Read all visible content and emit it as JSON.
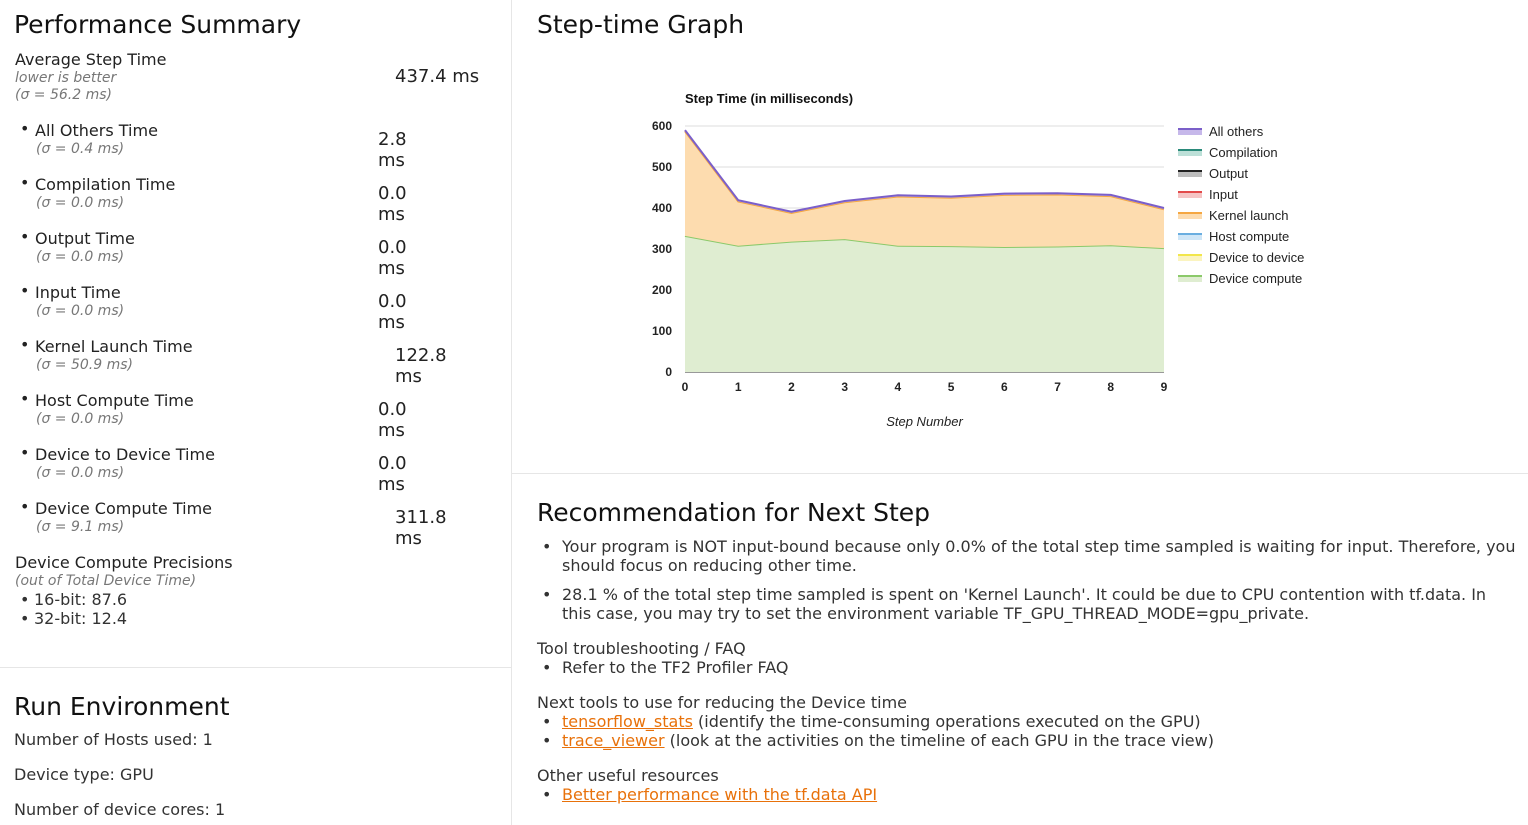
{
  "perf": {
    "title": "Performance Summary",
    "avg": {
      "name": "Average Step Time",
      "hint": "lower is better",
      "sigma": "(σ = 56.2 ms)",
      "value": "437.4 ms"
    },
    "breakdown": [
      {
        "name": "All Others Time",
        "sigma": "(σ = 0.4 ms)",
        "value": "2.8 ms"
      },
      {
        "name": "Compilation Time",
        "sigma": "(σ = 0.0 ms)",
        "value": "0.0 ms"
      },
      {
        "name": "Output Time",
        "sigma": "(σ = 0.0 ms)",
        "value": "0.0 ms"
      },
      {
        "name": "Input Time",
        "sigma": "(σ = 0.0 ms)",
        "value": "0.0 ms"
      },
      {
        "name": "Kernel Launch Time",
        "sigma": "(σ = 50.9 ms)",
        "value": "122.8 ms"
      },
      {
        "name": "Host Compute Time",
        "sigma": "(σ = 0.0 ms)",
        "value": "0.0 ms"
      },
      {
        "name": "Device to Device Time",
        "sigma": "(σ = 0.0 ms)",
        "value": "0.0 ms"
      },
      {
        "name": "Device Compute Time",
        "sigma": "(σ = 9.1 ms)",
        "value": "311.8 ms"
      }
    ],
    "precisions": {
      "title": "Device Compute Precisions",
      "sub": "(out of Total Device Time)",
      "items": [
        "16-bit: 87.6",
        "32-bit: 12.4"
      ]
    }
  },
  "run_env": {
    "title": "Run Environment",
    "hosts": "Number of Hosts used: 1",
    "device_type": "Device type: GPU",
    "cores": "Number of device cores: 1"
  },
  "graph_panel": {
    "title": "Step-time Graph"
  },
  "chart_data": {
    "type": "area",
    "title": "Step Time (in milliseconds)",
    "xlabel": "Step Number",
    "ylabel": "",
    "x": [
      0,
      1,
      2,
      3,
      4,
      5,
      6,
      7,
      8,
      9
    ],
    "ylim": [
      0,
      600
    ],
    "yticks": [
      0,
      100,
      200,
      300,
      400,
      500,
      600
    ],
    "stacked": true,
    "grid": true,
    "legend_position": "right",
    "series": [
      {
        "name": "All others",
        "color": "#7b5fc9",
        "values": [
          3,
          3,
          3,
          3,
          3,
          3,
          3,
          3,
          3,
          3
        ]
      },
      {
        "name": "Compilation",
        "color": "#2a8a7a",
        "values": [
          0,
          0,
          0,
          0,
          0,
          0,
          0,
          0,
          0,
          0
        ]
      },
      {
        "name": "Output",
        "color": "#222222",
        "values": [
          0,
          0,
          0,
          0,
          0,
          0,
          0,
          0,
          0,
          0
        ]
      },
      {
        "name": "Input",
        "color": "#e34a4a",
        "values": [
          0,
          0,
          0,
          0,
          0,
          0,
          0,
          0,
          0,
          0
        ]
      },
      {
        "name": "Kernel launch",
        "color": "#f5a742",
        "values": [
          255,
          108,
          70,
          90,
          120,
          118,
          127,
          127,
          120,
          95
        ]
      },
      {
        "name": "Host compute",
        "color": "#6aaee0",
        "values": [
          0,
          0,
          0,
          0,
          0,
          0,
          0,
          0,
          0,
          0
        ]
      },
      {
        "name": "Device to device",
        "color": "#f2e64b",
        "values": [
          0,
          0,
          0,
          0,
          0,
          0,
          0,
          0,
          0,
          0
        ]
      },
      {
        "name": "Device compute",
        "color": "#8bc96a",
        "values": [
          332,
          308,
          318,
          324,
          308,
          307,
          305,
          306,
          309,
          302
        ]
      }
    ]
  },
  "reco": {
    "title": "Recommendation for Next Step",
    "bullets": [
      "Your program is NOT input-bound because only 0.0% of the total step time sampled is waiting for input. Therefore, you should focus on reducing other time.",
      "28.1 % of the total step time sampled is spent on 'Kernel Launch'. It could be due to CPU contention with tf.data. In this case, you may try to set the environment variable TF_GPU_THREAD_MODE=gpu_private."
    ],
    "faq_title": "Tool troubleshooting / FAQ",
    "faq_item": "Refer to the TF2 Profiler FAQ",
    "next_title": "Next tools to use for reducing the Device time",
    "tools": [
      {
        "link": "tensorflow_stats",
        "desc": " (identify the time-consuming operations executed on the GPU)"
      },
      {
        "link": "trace_viewer",
        "desc": " (look at the activities on the timeline of each GPU in the trace view)"
      }
    ],
    "other_title": "Other useful resources",
    "other_link": "Better performance with the tf.data API"
  }
}
